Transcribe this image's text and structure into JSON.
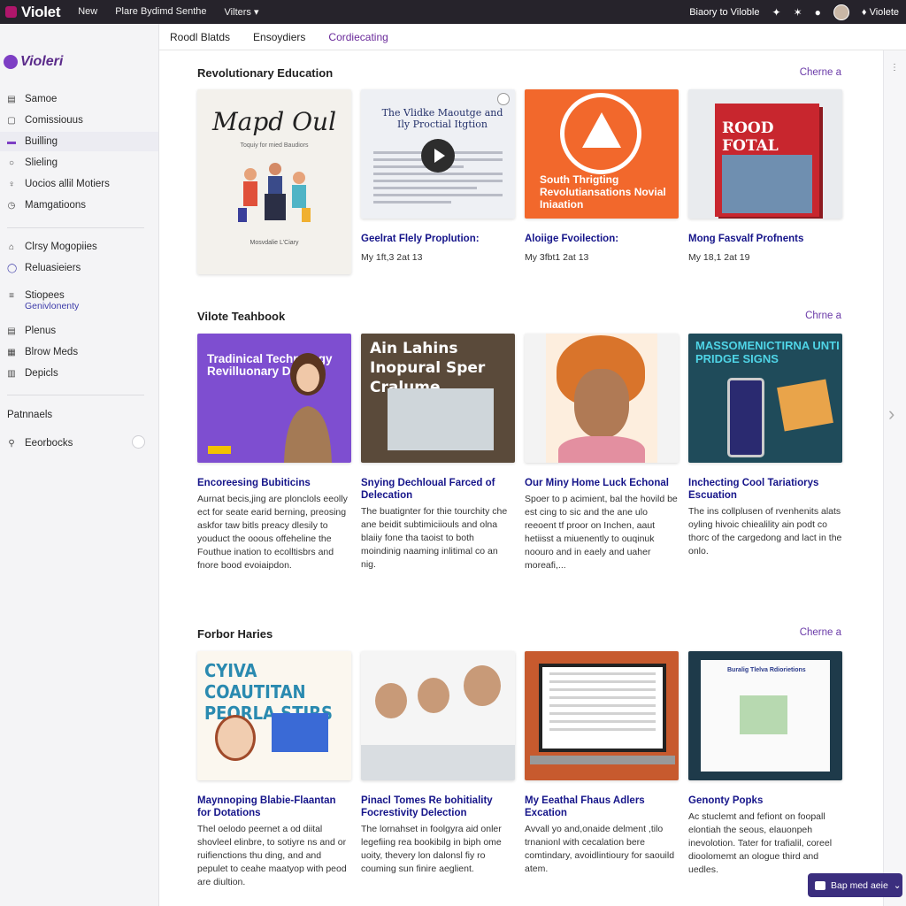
{
  "topbar": {
    "brand": "Violet",
    "nav": [
      "New",
      "Plare Bydimd Senthe",
      "Vilters"
    ],
    "right_link": "Biaory to Viloble",
    "right_user": "Violete"
  },
  "subtabs": [
    "Roodl Blatds",
    "Ensoydiers",
    "Cordiecating"
  ],
  "sidebar": {
    "logo": "Violeri",
    "items_top": [
      "Samoe",
      "Comissiouus",
      "Builling",
      "Slieling",
      "Uocios allil Motiers",
      "Mamgatioons"
    ],
    "items_mid": [
      "Clrsy Mogopiies",
      "Reluasieiers"
    ],
    "stopes": "Stiopees",
    "stopes_sub": "Genivlonenty",
    "items_low": [
      "Plenus",
      "Blrow Meds",
      "Depicls"
    ],
    "section": "Patnnaels",
    "bottom_item": "Eeorbocks"
  },
  "sections": [
    {
      "title": "Revolutionary Education",
      "link": "Cherne a",
      "cards": [
        {
          "thumb_title": "Mapd Oul",
          "thumb_sub": "Toquiy for mied Baudiors",
          "thumb_footer": "Mosvdalie L'Ciary",
          "title": "",
          "meta": "",
          "desc": ""
        },
        {
          "thumb_title": "The Vlidke Maoutge and Ily Proctial Itgtion",
          "title": "Geelrat Flely Proplution:",
          "meta": "My 1ft,3 2at 13",
          "desc": ""
        },
        {
          "thumb_title": "South Thrigting Revolutiansations Novial Iniaation",
          "title": "Aloiige Fvoilection:",
          "meta": "My 3fbt1 2at 13",
          "desc": ""
        },
        {
          "thumb_title": "ROOD FOTAL",
          "title": "Mong Fasvalf Profnents",
          "meta": "My 18,1 2at 19",
          "desc": ""
        }
      ]
    },
    {
      "title": "Vilote Teahbook",
      "link": "Chrne a",
      "cards": [
        {
          "thumb_title": "Tradinical Techmoogy Revilluonary Dlidelts",
          "title": "Encoreesing Bubiticins",
          "meta": "",
          "desc": "Aurnat becis,jing are plonclols eeolly ect for seate earid berning, preosing askfor taw bitls preacy dlesily to youduct the ooous offeheline the Fouthue ination to ecolltisbrs and fnore bood evoiaipdon."
        },
        {
          "thumb_title": "Ain Lahins Inopural Sper Cralume",
          "title": "Snying Dechloual Farced of Delecation",
          "meta": "",
          "desc": "The buatignter for thie tourchity che ane beidit subtimiciiouls and olna blaiiy fone tha taoist to both moindinig naaming inlitimal co an nig."
        },
        {
          "thumb_title": "",
          "title": "Our Miny Home Luck Echonal",
          "meta": "",
          "desc": "Spoer to p acimient, bal the hovild be est cing to sic and the ane ulo reeoent tf proor on Inchen, aaut hetiisst a miuenently to ouqinuk noouro and in eaely and uaher moreafi,..."
        },
        {
          "thumb_title": "MASSOMENICTIRNA UNTI PRIDGE SIGNS",
          "title": "Inchecting Cool Tariatiorys Escuation",
          "meta": "",
          "desc": "The ins collplusen of rvenhenits alats oyling hivoic chiealility ain podt co thorc of the cargedong and lact in the onlo."
        }
      ]
    },
    {
      "title": "Forbor Haries",
      "link": "Cherne a",
      "cards": [
        {
          "thumb_title": "CYIVA COAUTITAN PEORLA STIRS",
          "title": "Maynnoping Blabie-Flaantan for Dotations",
          "meta": "",
          "desc": "Thel oelodo peernet a od diital shovleel elinbre, to sotiyre ns and or ruifienctions thu ding, and and pepulet to ceahe maatyop with peod are diultion."
        },
        {
          "thumb_title": "",
          "title": "Pinacl Tomes Re bohitiality Focrestivity Delection",
          "meta": "",
          "desc": "The lornahset in foolgyra aid onler legefiing rea bookibilg in biph ome uoity, thevery lon dalonsl fiy ro couming sun finire aeglient."
        },
        {
          "thumb_title": "",
          "title": "My Eeathal Fhaus Adlers Excation",
          "meta": "",
          "desc": "Avvall yo and,onaide delment ,tilo trnanionl with cecalation bere comtindary, avoidlintioury for saouild atem."
        },
        {
          "thumb_title": "Buralig Tlelva Rdiorietions",
          "title": "Genonty Popks",
          "meta": "",
          "desc": "Ac stuclemt and fefiont on foopall elontiah the seous, elauonpeh inevolotion. Tater for trafialil, coreel dioolomemt an ologue third and uedles."
        }
      ]
    }
  ],
  "chat_widget": "Bap med aeie"
}
